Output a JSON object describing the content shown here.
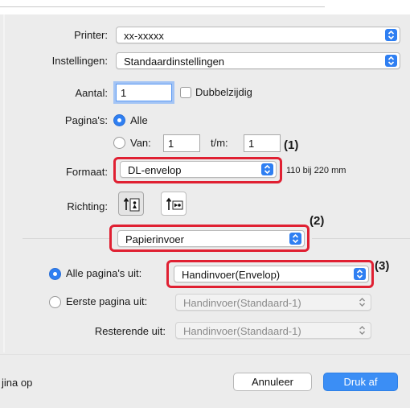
{
  "dialog": {
    "printer_label": "Printer:",
    "printer_value": "xx-xxxxx",
    "presets_label": "Instellingen:",
    "presets_value": "Standaardinstellingen",
    "copies_label": "Aantal:",
    "copies_value": "1",
    "two_sided_label": "Dubbelzijdig",
    "pages_label": "Pagina's:",
    "pages_all_label": "Alle",
    "pages_from_label": "Van:",
    "pages_from_value": "1",
    "pages_to_label": "t/m:",
    "pages_to_value": "1",
    "paper_size_label": "Formaat:",
    "paper_size_value": "DL-envelop",
    "paper_size_dims": "110 bij 220 mm",
    "orientation_label": "Richting:",
    "panel_value": "Papierinvoer",
    "all_pages_from_label": "Alle pagina's uit:",
    "all_pages_from_value": "Handinvoer(Envelop)",
    "first_page_from_label": "Eerste pagina uit:",
    "first_page_from_value": "Handinvoer(Standaard-1)",
    "remaining_from_label": "Resterende uit:",
    "remaining_from_value": "Handinvoer(Standaard-1)",
    "left_bottom_text": "jina op",
    "cancel_label": "Annuleer",
    "print_label": "Druk af"
  },
  "annotations": {
    "step1": "(1)",
    "step2": "(2)",
    "step3": "(3)"
  },
  "colors": {
    "accent_blue": "#2f7ff2",
    "annotation_red": "#e02032",
    "dialog_bg": "#ececec"
  },
  "icons": {
    "popup_arrow": "chevron-updown-icon",
    "portrait": "portrait-orientation-icon",
    "landscape": "landscape-orientation-icon"
  }
}
